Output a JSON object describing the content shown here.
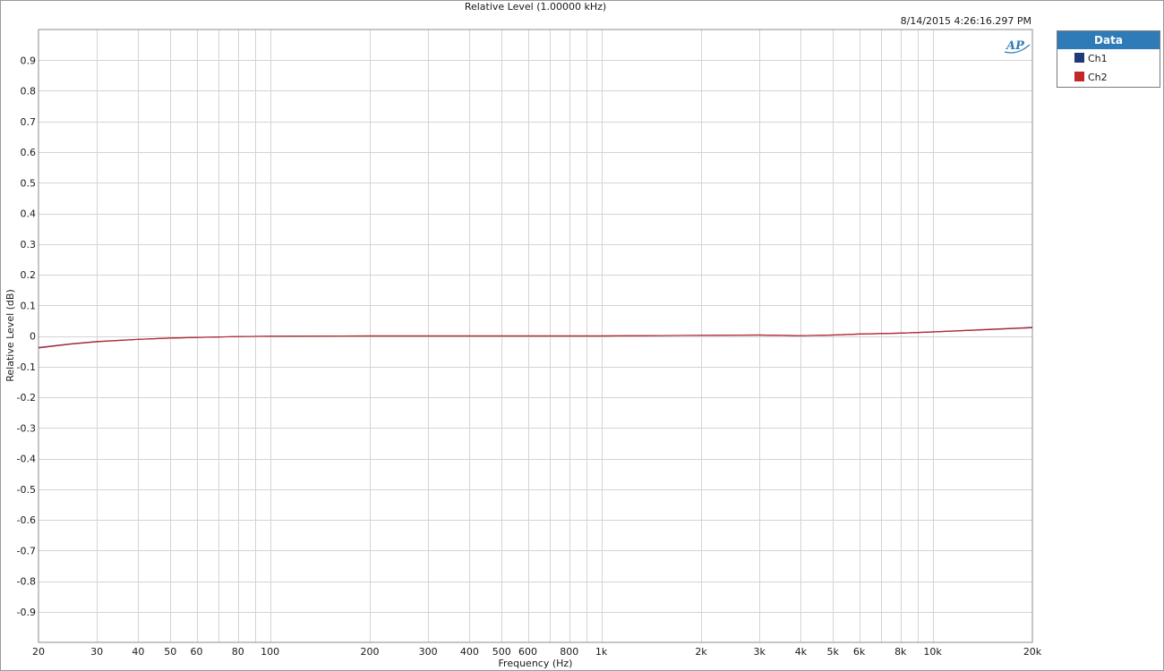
{
  "chart_data": {
    "type": "line",
    "title": "Relative Level (1.00000 kHz)",
    "timestamp": "8/14/2015 4:26:16.297 PM",
    "xlabel": "Frequency (Hz)",
    "ylabel": "Relative Level (dB)",
    "xscale": "log",
    "xlim": [
      20,
      20000
    ],
    "ylim": [
      -1.0,
      1.0
    ],
    "grid": true,
    "x_ticks": [
      {
        "value": 20,
        "label": "20"
      },
      {
        "value": 30,
        "label": "30"
      },
      {
        "value": 40,
        "label": "40"
      },
      {
        "value": 50,
        "label": "50"
      },
      {
        "value": 60,
        "label": "60"
      },
      {
        "value": 80,
        "label": "80"
      },
      {
        "value": 100,
        "label": "100"
      },
      {
        "value": 200,
        "label": "200"
      },
      {
        "value": 300,
        "label": "300"
      },
      {
        "value": 400,
        "label": "400"
      },
      {
        "value": 500,
        "label": "500"
      },
      {
        "value": 600,
        "label": "600"
      },
      {
        "value": 800,
        "label": "800"
      },
      {
        "value": 1000,
        "label": "1k"
      },
      {
        "value": 2000,
        "label": "2k"
      },
      {
        "value": 3000,
        "label": "3k"
      },
      {
        "value": 4000,
        "label": "4k"
      },
      {
        "value": 5000,
        "label": "5k"
      },
      {
        "value": 6000,
        "label": "6k"
      },
      {
        "value": 8000,
        "label": "8k"
      },
      {
        "value": 10000,
        "label": "10k"
      },
      {
        "value": 20000,
        "label": "20k"
      }
    ],
    "x_minor_grid": [
      70,
      90,
      700,
      900,
      7000,
      9000
    ],
    "y_ticks": [
      {
        "value": 0.9,
        "label": "0.9"
      },
      {
        "value": 0.8,
        "label": "0.8"
      },
      {
        "value": 0.7,
        "label": "0.7"
      },
      {
        "value": 0.6,
        "label": "0.6"
      },
      {
        "value": 0.5,
        "label": "0.5"
      },
      {
        "value": 0.4,
        "label": "0.4"
      },
      {
        "value": 0.3,
        "label": "0.3"
      },
      {
        "value": 0.2,
        "label": "0.2"
      },
      {
        "value": 0.1,
        "label": "0.1"
      },
      {
        "value": 0,
        "label": "0"
      },
      {
        "value": -0.1,
        "label": "-0.1"
      },
      {
        "value": -0.2,
        "label": "-0.2"
      },
      {
        "value": -0.3,
        "label": "-0.3"
      },
      {
        "value": -0.4,
        "label": "-0.4"
      },
      {
        "value": -0.5,
        "label": "-0.5"
      },
      {
        "value": -0.6,
        "label": "-0.6"
      },
      {
        "value": -0.7,
        "label": "-0.7"
      },
      {
        "value": -0.8,
        "label": "-0.8"
      },
      {
        "value": -0.9,
        "label": "-0.9"
      }
    ],
    "series": [
      {
        "name": "Ch1",
        "color": "#1f3a7a",
        "x": [
          20,
          25,
          30,
          40,
          50,
          60,
          80,
          100,
          200,
          300,
          500,
          1000,
          2000,
          3000,
          4000,
          5000,
          6000,
          8000,
          10000,
          15000,
          20000
        ],
        "y": [
          -0.038,
          -0.026,
          -0.018,
          -0.011,
          -0.007,
          -0.005,
          -0.002,
          -0.001,
          0.0,
          0.0,
          0.0,
          0.0,
          0.002,
          0.003,
          0.001,
          0.003,
          0.006,
          0.009,
          0.013,
          0.021,
          0.027
        ]
      },
      {
        "name": "Ch2",
        "color": "#c0282a",
        "x": [
          20,
          25,
          30,
          40,
          50,
          60,
          80,
          100,
          200,
          300,
          500,
          1000,
          2000,
          3000,
          4000,
          5000,
          6000,
          8000,
          10000,
          15000,
          20000
        ],
        "y": [
          -0.039,
          -0.027,
          -0.019,
          -0.011,
          -0.007,
          -0.005,
          -0.002,
          -0.001,
          0.0,
          0.0,
          0.0,
          0.0,
          0.002,
          0.003,
          0.001,
          0.003,
          0.006,
          0.009,
          0.013,
          0.022,
          0.028
        ]
      }
    ]
  },
  "legend": {
    "title": "Data",
    "items": [
      {
        "label": "Ch1",
        "color": "#1f3a7a"
      },
      {
        "label": "Ch2",
        "color": "#c0282a"
      }
    ]
  },
  "logo_text": "AP"
}
